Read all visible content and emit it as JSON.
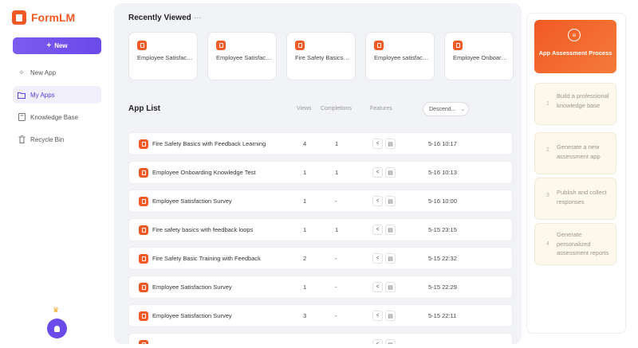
{
  "brand": {
    "name": "FormLM"
  },
  "sidebar": {
    "new_label": "New",
    "items": [
      {
        "label": "New App",
        "icon": "sparkle-icon"
      },
      {
        "label": "My Apps",
        "icon": "folder-icon"
      },
      {
        "label": "Knowledge Base",
        "icon": "book-icon"
      },
      {
        "label": "Recycle Bin",
        "icon": "trash-icon"
      }
    ]
  },
  "recent": {
    "title": "Recently Viewed",
    "more": "···",
    "cards": [
      {
        "label": "Employee Satisfaction Survey"
      },
      {
        "label": "Employee Satisfaction Survey"
      },
      {
        "label": "Fire Safety Basics with Feedback Learning"
      },
      {
        "label": "Employee satisfaction survey"
      },
      {
        "label": "Employee Onboarding Knowledge Test"
      }
    ]
  },
  "applist": {
    "title": "App List",
    "columns": {
      "views": "Views",
      "completions": "Completions",
      "features": "Features"
    },
    "sort": "Descend...",
    "rows": [
      {
        "name": "Fire Safety Basics with Feedback Learning",
        "views": "4",
        "completions": "1",
        "date": "5-16 10:17"
      },
      {
        "name": "Employee Onboarding Knowledge Test",
        "views": "1",
        "completions": "1",
        "date": "5-16 10:13"
      },
      {
        "name": "Employee Satisfaction Survey",
        "views": "1",
        "completions": "-",
        "date": "5-16 10:00"
      },
      {
        "name": "Fire safety basics with feedback loops",
        "views": "1",
        "completions": "1",
        "date": "5-15 23:15"
      },
      {
        "name": "Fire Safety Basic Training with Feedback",
        "views": "2",
        "completions": "-",
        "date": "5-15 22:32"
      },
      {
        "name": "Employee Satisfaction Survey",
        "views": "1",
        "completions": "-",
        "date": "5-15 22:29"
      },
      {
        "name": "Employee Satisfaction Survey",
        "views": "3",
        "completions": "-",
        "date": "5-15 22:11"
      }
    ]
  },
  "process": {
    "title": "App Assessment Process",
    "steps": [
      {
        "num": "1",
        "text": "Build a professional knowledge base"
      },
      {
        "num": "2",
        "text": "Generate a new assessment app"
      },
      {
        "num": "3",
        "text": "Publish and collect responses"
      },
      {
        "num": "4",
        "text": "Generate personalized assessment reports"
      }
    ]
  },
  "colors": {
    "brand": "#f15a24",
    "accent": "#6a4ae8"
  }
}
